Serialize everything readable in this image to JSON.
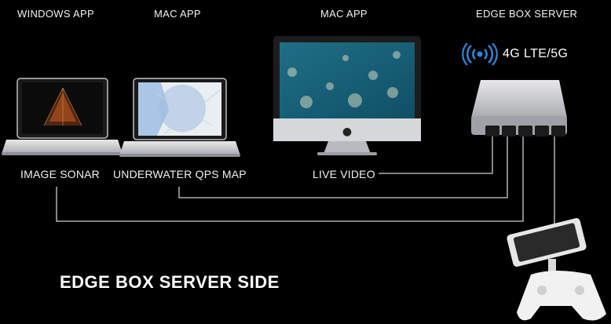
{
  "headers": {
    "windows_app": "WINDOWS APP",
    "mac_app_1": "MAC APP",
    "mac_app_2": "MAC APP",
    "edge_box_server": "EDGE BOX SERVER"
  },
  "labels": {
    "image_sonar": "IMAGE SONAR",
    "underwater_map": "UNDERWATER QPS MAP",
    "live_video": "LIVE VIDEO"
  },
  "connectivity": {
    "text": "4G LTE/5G",
    "icon": "wireless-broadcast-icon",
    "color": "#2f86d9"
  },
  "title": "EDGE BOX SERVER SIDE",
  "colors": {
    "background": "#000000",
    "line": "#cfcfcf",
    "accent": "#2f86d9"
  }
}
